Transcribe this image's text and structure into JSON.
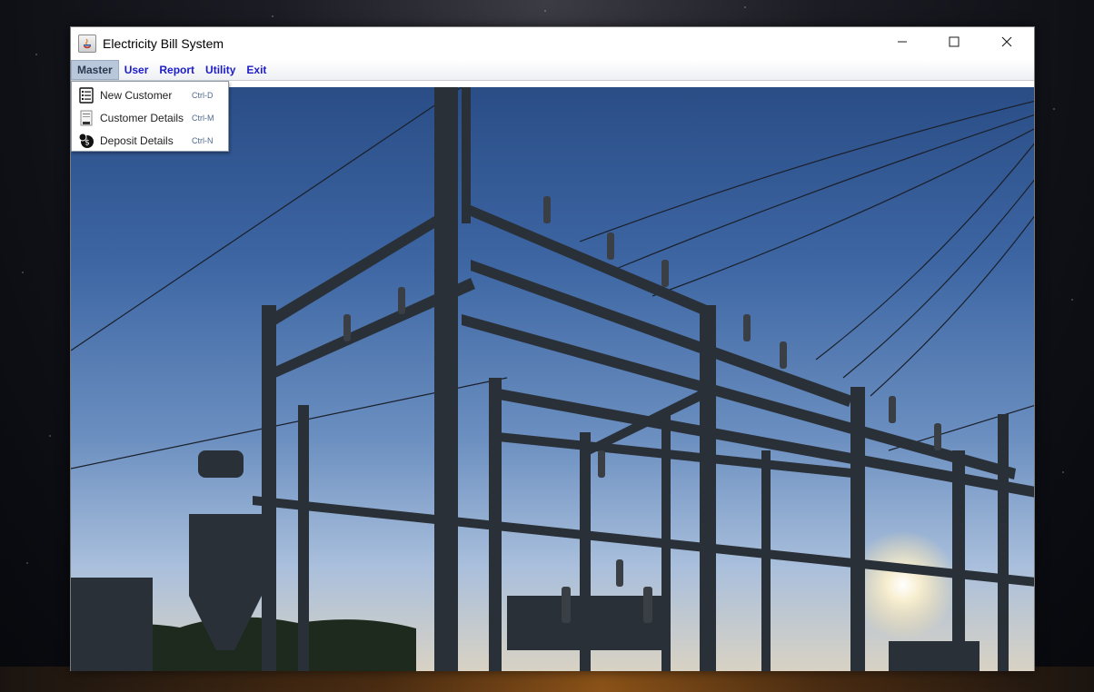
{
  "window": {
    "title": "Electricity Bill System",
    "controls": {
      "minimize": "─",
      "maximize": "☐",
      "close": "✕"
    }
  },
  "menubar": {
    "items": [
      {
        "label": "Master",
        "active": true
      },
      {
        "label": "User"
      },
      {
        "label": "Report"
      },
      {
        "label": "Utility"
      },
      {
        "label": "Exit"
      }
    ]
  },
  "dropdown": {
    "items": [
      {
        "label": "New Customer",
        "accelerator": "Ctrl-D",
        "icon": "list-icon"
      },
      {
        "label": "Customer Details",
        "accelerator": "Ctrl-M",
        "icon": "document-icon"
      },
      {
        "label": "Deposit Details",
        "accelerator": "Ctrl-N",
        "icon": "deposit-icon"
      }
    ]
  },
  "colors": {
    "menu_text": "#1c1cc8",
    "menu_active_bg": "#b8c7d9",
    "sky_top": "#2a4d86",
    "sky_bottom": "#d8d2c4"
  }
}
